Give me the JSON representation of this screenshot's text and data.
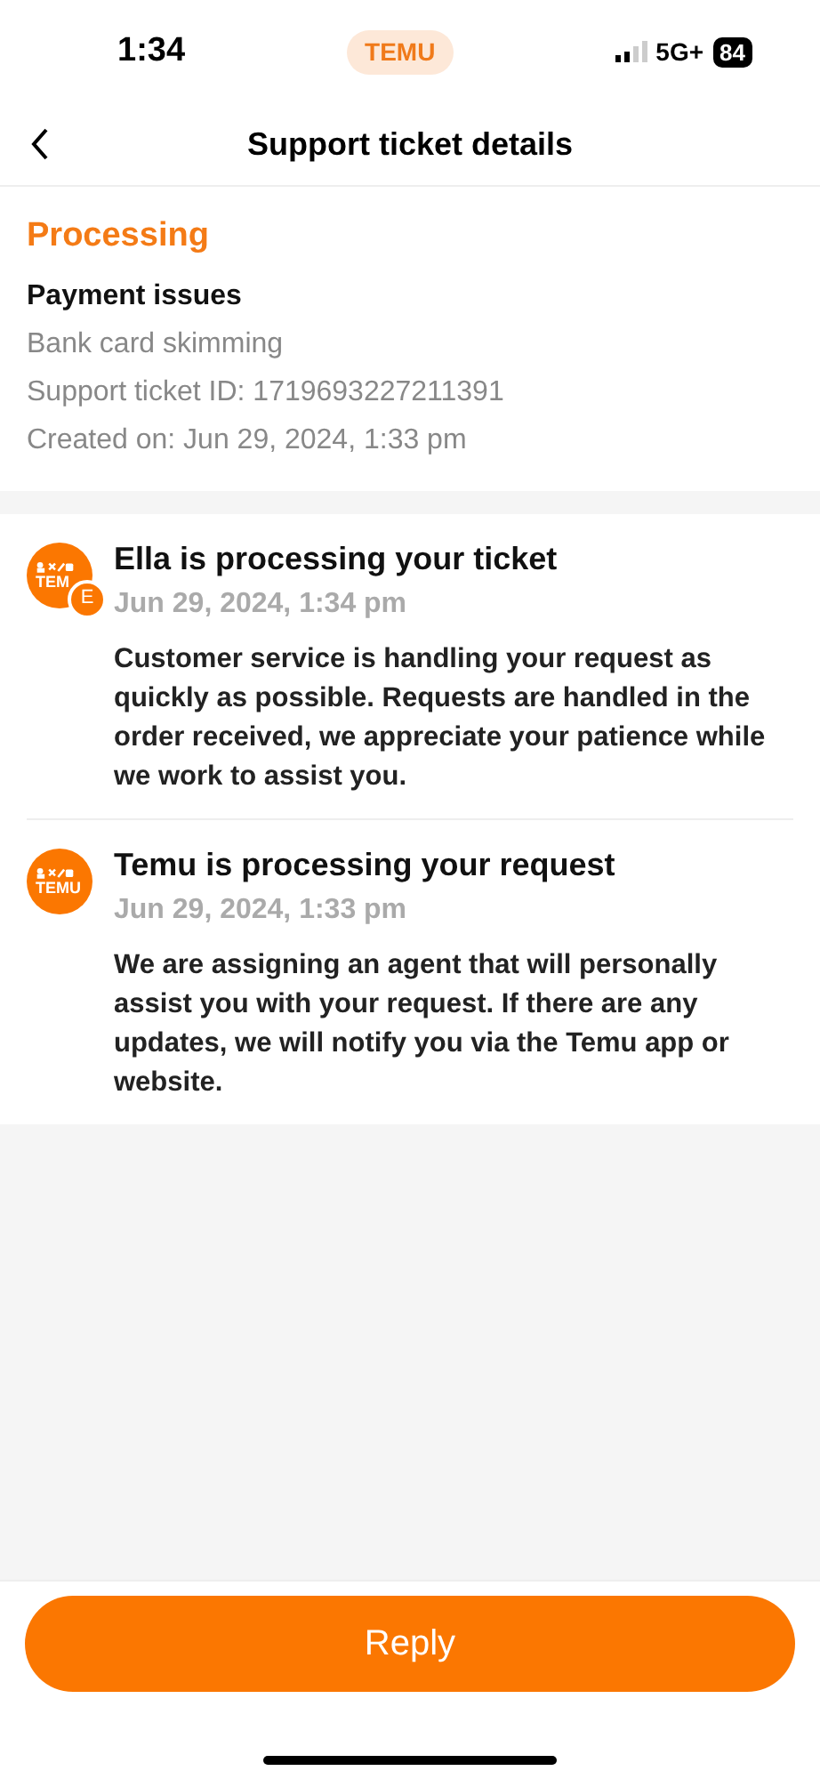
{
  "status_bar": {
    "time": "1:34",
    "app_pill": "TEMU",
    "network": "5G+",
    "battery": "84"
  },
  "header": {
    "title": "Support ticket details"
  },
  "ticket": {
    "status": "Processing",
    "category": "Payment issues",
    "subcategory": "Bank card skimming",
    "id_line": "Support ticket ID: 1719693227211391",
    "created_line": "Created on: Jun 29, 2024, 1:33 pm"
  },
  "messages": [
    {
      "avatar_text": "TEM",
      "badge": "E",
      "title": "Ella is processing your ticket",
      "time": "Jun 29, 2024, 1:34 pm",
      "body": "Customer service is handling your request as quickly as possible. Requests are handled in the order received, we appreciate your patience while we work to assist you."
    },
    {
      "avatar_text": "TEMU",
      "title": "Temu is processing your request",
      "time": "Jun 29, 2024, 1:33 pm",
      "body": "We are assigning an agent that will personally assist you with your request. If there are any updates, we will notify you via the Temu app or website."
    }
  ],
  "reply_button": "Reply"
}
